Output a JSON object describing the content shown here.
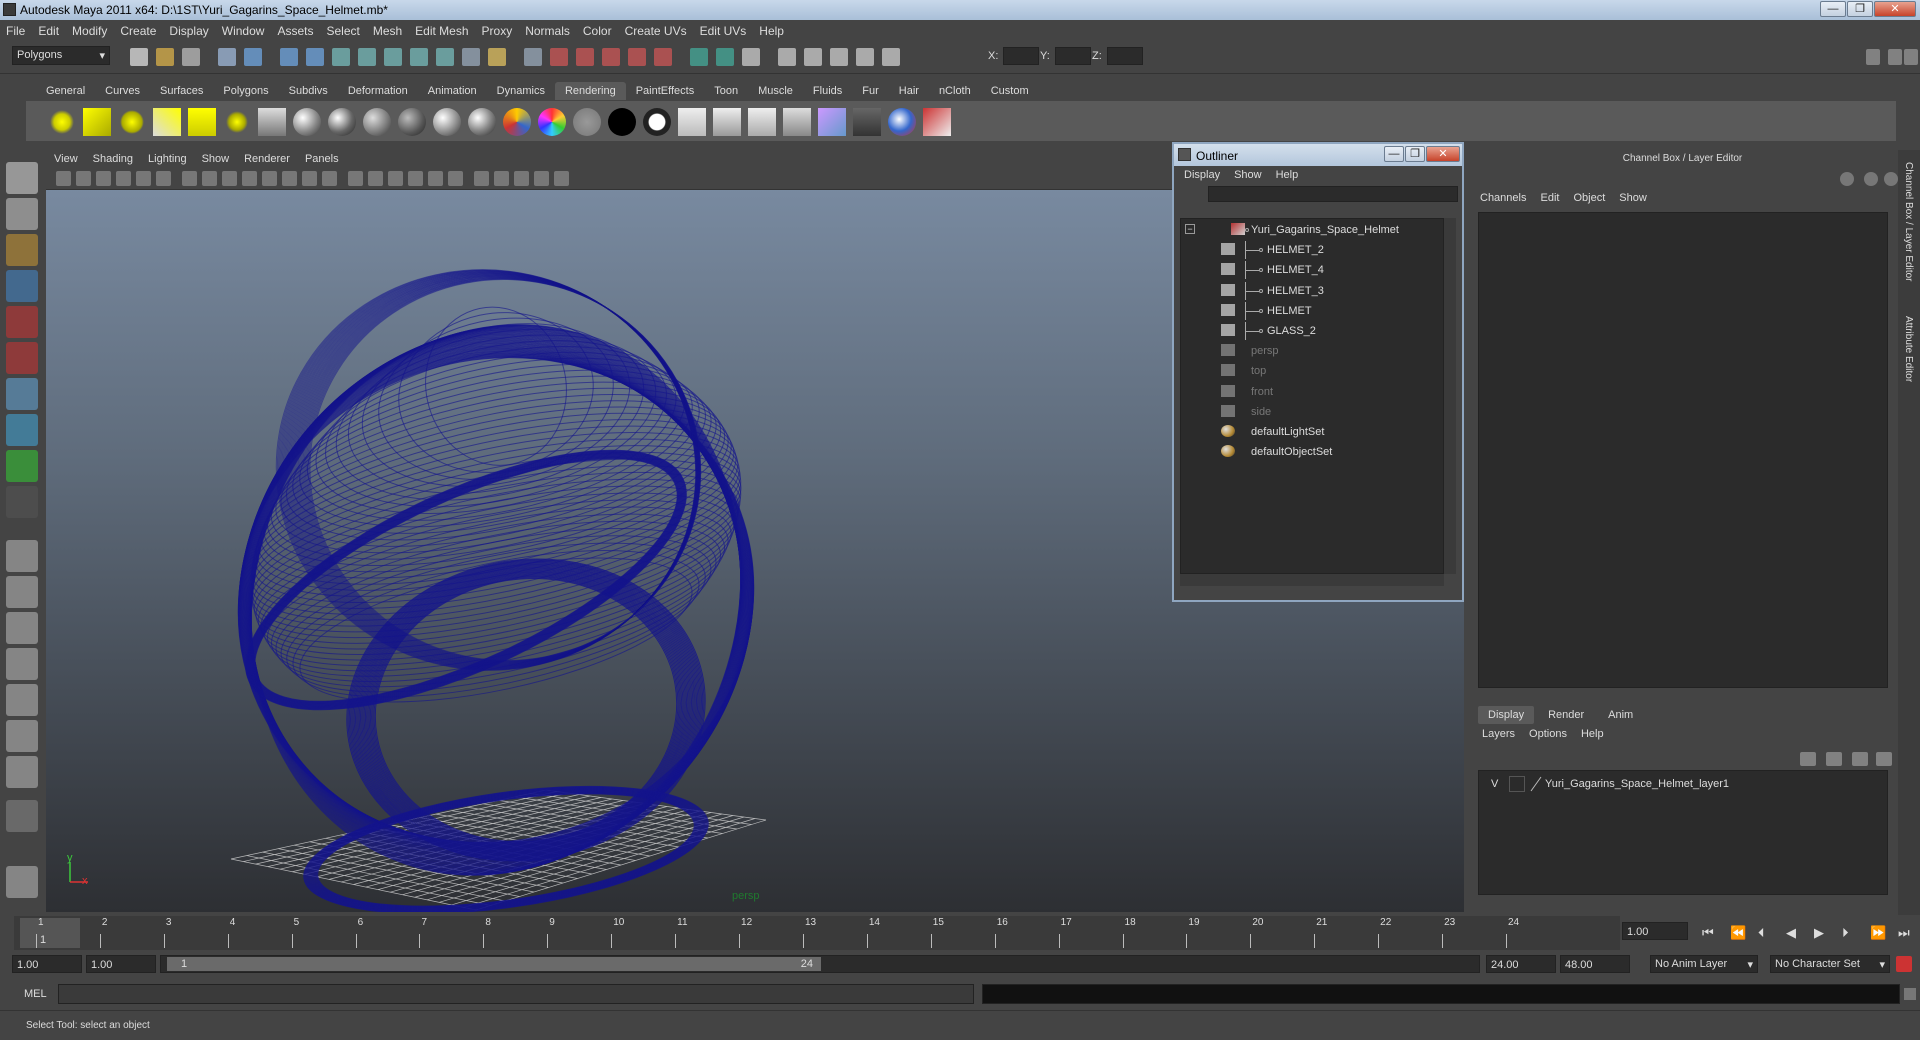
{
  "window": {
    "title": "Autodesk Maya 2011 x64: D:\\1ST\\Yuri_Gagarins_Space_Helmet.mb*",
    "min": "—",
    "max": "❐",
    "close": "✕"
  },
  "menubar": [
    "File",
    "Edit",
    "Modify",
    "Create",
    "Display",
    "Window",
    "Assets",
    "Select",
    "Mesh",
    "Edit Mesh",
    "Proxy",
    "Normals",
    "Color",
    "Create UVs",
    "Edit UVs",
    "Help"
  ],
  "statusline": {
    "mode": "Polygons",
    "x_label": "X:",
    "y_label": "Y:",
    "z_label": "Z:"
  },
  "shelf_tabs": [
    "General",
    "Curves",
    "Surfaces",
    "Polygons",
    "Subdivs",
    "Deformation",
    "Animation",
    "Dynamics",
    "Rendering",
    "PaintEffects",
    "Toon",
    "Muscle",
    "Fluids",
    "Fur",
    "Hair",
    "nCloth",
    "Custom"
  ],
  "shelf_active": "Rendering",
  "viewport": {
    "menu": [
      "View",
      "Shading",
      "Lighting",
      "Show",
      "Renderer",
      "Panels"
    ],
    "camera_label": "persp",
    "axis_y": "y",
    "axis_x": "x"
  },
  "outliner": {
    "title": "Outliner",
    "menu": [
      "Display",
      "Show",
      "Help"
    ],
    "collapse": "−",
    "items": [
      {
        "label": "Yuri_Gagarins_Space_Helmet",
        "depth": 0,
        "dim": false,
        "icon": "transform-icon"
      },
      {
        "label": "HELMET_2",
        "depth": 1,
        "dim": false,
        "icon": "mesh-icon"
      },
      {
        "label": "HELMET_4",
        "depth": 1,
        "dim": false,
        "icon": "mesh-icon"
      },
      {
        "label": "HELMET_3",
        "depth": 1,
        "dim": false,
        "icon": "mesh-icon"
      },
      {
        "label": "HELMET",
        "depth": 1,
        "dim": false,
        "icon": "mesh-icon"
      },
      {
        "label": "GLASS_2",
        "depth": 1,
        "dim": false,
        "icon": "mesh-icon"
      },
      {
        "label": "persp",
        "depth": 0,
        "dim": true,
        "icon": "camera-icon"
      },
      {
        "label": "top",
        "depth": 0,
        "dim": true,
        "icon": "camera-icon"
      },
      {
        "label": "front",
        "depth": 0,
        "dim": true,
        "icon": "camera-icon"
      },
      {
        "label": "side",
        "depth": 0,
        "dim": true,
        "icon": "camera-icon"
      },
      {
        "label": "defaultLightSet",
        "depth": 0,
        "dim": false,
        "icon": "set-icon"
      },
      {
        "label": "defaultObjectSet",
        "depth": 0,
        "dim": false,
        "icon": "set-icon"
      }
    ]
  },
  "channelbox": {
    "header": "Channel Box / Layer Editor",
    "menu": [
      "Channels",
      "Edit",
      "Object",
      "Show"
    ],
    "layer_tabs": [
      "Display",
      "Render",
      "Anim"
    ],
    "layer_active": "Display",
    "layer_menu": [
      "Layers",
      "Options",
      "Help"
    ],
    "layers": [
      {
        "visible": "V",
        "name": "Yuri_Gagarins_Space_Helmet_layer1"
      }
    ]
  },
  "side_tabs": [
    "Channel Box / Layer Editor",
    "Attribute Editor"
  ],
  "timeslider": {
    "ticks": [
      "1",
      "2",
      "3",
      "4",
      "5",
      "6",
      "7",
      "8",
      "9",
      "10",
      "11",
      "12",
      "13",
      "14",
      "15",
      "16",
      "17",
      "18",
      "19",
      "20",
      "21",
      "22",
      "23",
      "24"
    ],
    "current": "1",
    "current_frame_field": "1.00"
  },
  "range": {
    "start": "1.00",
    "playback_start": "1.00",
    "slider_start": "1",
    "slider_end": "24",
    "playback_end": "24.00",
    "end": "48.00",
    "anim_layer": "No Anim Layer",
    "char_set": "No Character Set"
  },
  "cmd": {
    "label": "MEL"
  },
  "help": {
    "text": "Select Tool: select an object"
  },
  "colors": {
    "wire": "#14148c",
    "accent": "#8fa6c0"
  }
}
